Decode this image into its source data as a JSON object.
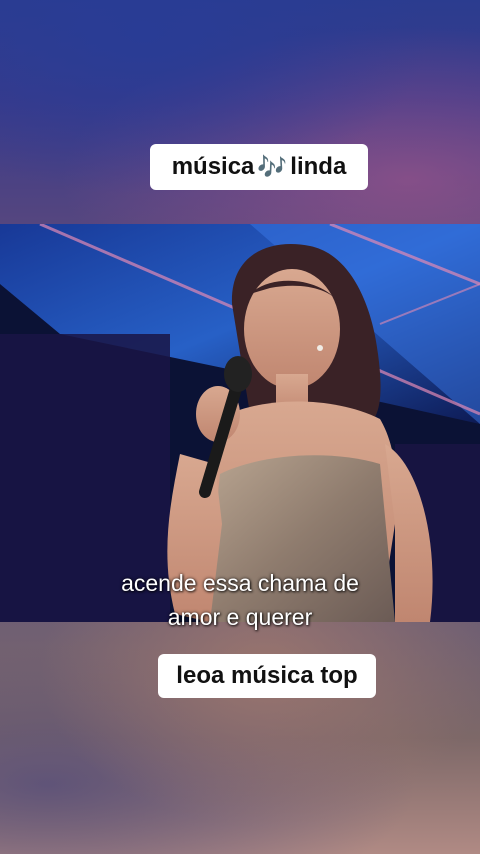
{
  "sticker_top": {
    "text_before": "música",
    "icon": "musical-notes-icon",
    "icon_glyph": "🎶",
    "text_after": "linda"
  },
  "subtitle": {
    "line1": "acende essa chama de",
    "line2": "amor e querer"
  },
  "sticker_bottom": {
    "text": "leoa música top"
  },
  "colors": {
    "sticker_bg": "#ffffff",
    "note_purple": "#9c3fd6",
    "stage_blue": "#16256a"
  }
}
